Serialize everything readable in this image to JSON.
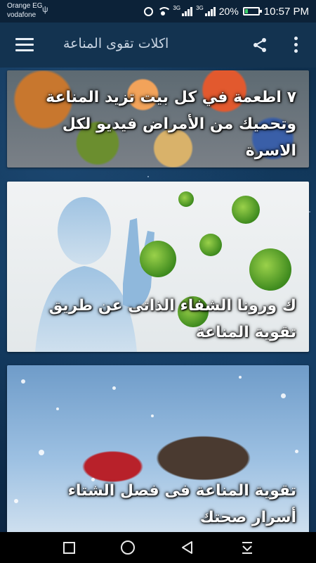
{
  "status_bar": {
    "carrier_line1": "Orange EG",
    "carrier_line2": "vodafone",
    "net1": "3G",
    "net2": "3G",
    "battery": "20%",
    "battery_level": 0.2,
    "time": "10:57 PM"
  },
  "app_bar": {
    "title": "اكلات تقوى المناعة",
    "icons": [
      "menu-icon",
      "share-icon",
      "more-vert-icon"
    ]
  },
  "articles": [
    {
      "title": "٧ اطعمة في كل بيت تزيد المناعة وتحميك من الأمراض فيديو لكل الاسرة"
    },
    {
      "title": "ك ورونا الشفاء الذاتى عن طريق تقوية المناعة"
    },
    {
      "title": "تقوية المناعة فى فصل الشتاء أسرار صحتك"
    }
  ],
  "nav_bar": {
    "icons": [
      "recents-icon",
      "home-icon",
      "back-icon",
      "notifications-pull-icon"
    ]
  },
  "colors": {
    "app_bar": "#133350",
    "status_bar": "#0c2238",
    "background": "#0d2a45",
    "virus_green": "#5aa82a"
  }
}
